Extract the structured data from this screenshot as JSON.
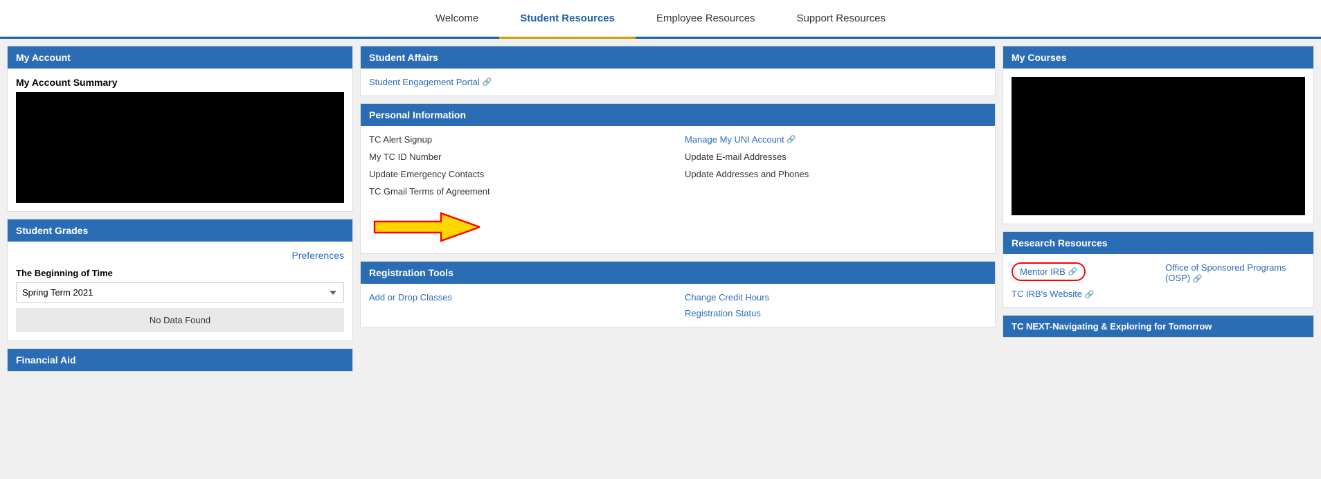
{
  "nav": {
    "items": [
      {
        "label": "Welcome",
        "active": false
      },
      {
        "label": "Student Resources",
        "active": true
      },
      {
        "label": "Employee Resources",
        "active": false
      },
      {
        "label": "Support Resources",
        "active": false
      }
    ]
  },
  "left_col": {
    "my_account": {
      "header": "My Account",
      "summary_label": "My Account Summary"
    },
    "student_grades": {
      "header": "Student Grades",
      "preferences_label": "Preferences",
      "grade_period_label": "The Beginning of Time",
      "term_options": [
        "Spring Term 2021"
      ],
      "selected_term": "Spring Term 2021",
      "no_data_label": "No Data Found"
    },
    "financial_aid": {
      "header": "Financial Aid"
    }
  },
  "middle_col": {
    "student_affairs": {
      "header": "Student Affairs",
      "links": [
        {
          "label": "Student Engagement Portal",
          "external": true
        }
      ]
    },
    "personal_information": {
      "header": "Personal Information",
      "items": [
        {
          "label": "TC Alert Signup",
          "col": 1
        },
        {
          "label": "Manage My UNI Account",
          "col": 2,
          "external": true
        },
        {
          "label": "My TC ID Number",
          "col": 1
        },
        {
          "label": "Update E-mail Addresses",
          "col": 2
        },
        {
          "label": "Update Emergency Contacts",
          "col": 1
        },
        {
          "label": "Update Addresses and Phones",
          "col": 2
        },
        {
          "label": "TC Gmail Terms of Agreement",
          "col": 1
        }
      ]
    },
    "registration_tools": {
      "header": "Registration Tools",
      "items": [
        {
          "label": "Add or Drop Classes",
          "col": 1
        },
        {
          "label": "Change Credit Hours",
          "col": 2
        },
        {
          "label": "",
          "col": 1
        },
        {
          "label": "Registration Status",
          "col": 2
        }
      ]
    }
  },
  "right_col": {
    "my_courses": {
      "header": "My Courses"
    },
    "research_resources": {
      "header": "Research Resources",
      "items": [
        {
          "label": "Mentor IRB",
          "external": true,
          "circled": true
        },
        {
          "label": "Office of Sponsored Programs (OSP)",
          "external": true,
          "circled": false
        },
        {
          "label": "TC IRB's Website",
          "external": true,
          "circled": false
        }
      ]
    },
    "tc_next": {
      "header": "TC NEXT-Navigating & Exploring for Tomorrow"
    }
  }
}
